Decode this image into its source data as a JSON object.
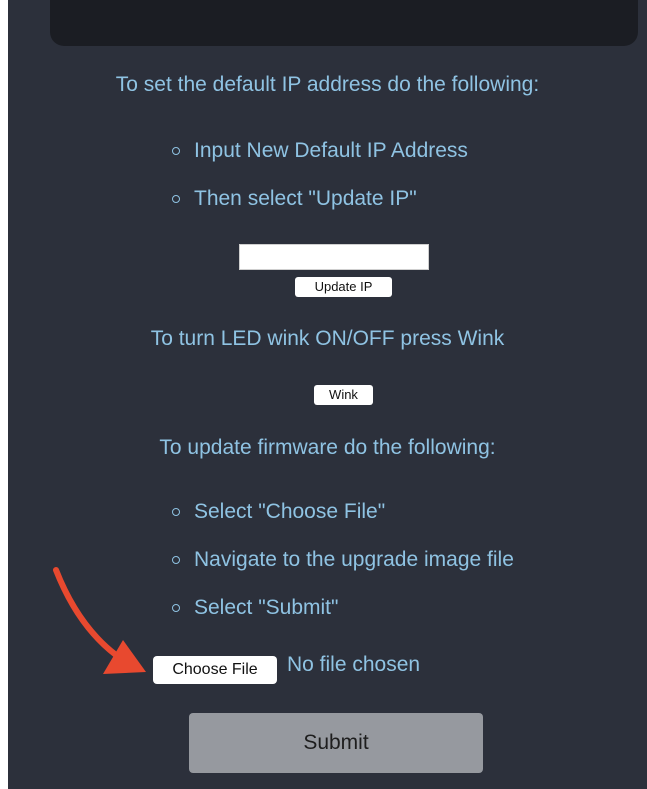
{
  "ip_section": {
    "heading": "To set the default IP address do the following:",
    "steps": [
      "Input New Default IP Address",
      "Then select \"Update IP\""
    ],
    "ip_input_value": "",
    "update_button_label": "Update IP"
  },
  "wink_section": {
    "heading": "To turn LED wink ON/OFF press Wink",
    "wink_button_label": "Wink"
  },
  "firmware_section": {
    "heading": "To update firmware do the following:",
    "steps": [
      "Select \"Choose File\"",
      "Navigate to the upgrade image file",
      "Select \"Submit\""
    ],
    "choose_file_label": "Choose File",
    "file_status": "No file chosen",
    "submit_label": "Submit"
  },
  "annotation": {
    "arrow_color": "#e8492f",
    "arrow_icon": "red-arrow-icon"
  },
  "colors": {
    "background": "#2c303b",
    "text": "#8fc3e3",
    "submit": "#96999f"
  }
}
